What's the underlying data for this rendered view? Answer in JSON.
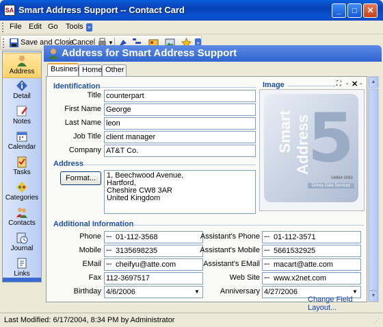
{
  "window": {
    "title": "Smart Address Support -- Contact Card",
    "app_icon_text": "SA"
  },
  "menu": {
    "items": [
      "File",
      "Edit",
      "Go",
      "Tools"
    ]
  },
  "toolbar": {
    "save_close": "Save and Close",
    "cancel": "Cancel"
  },
  "nav": {
    "items": [
      {
        "label": "Address",
        "icon": "person-icon",
        "active": true
      },
      {
        "label": "Detail",
        "icon": "info-icon"
      },
      {
        "label": "Notes",
        "icon": "notes-icon"
      },
      {
        "label": "Calendar",
        "icon": "calendar-icon"
      },
      {
        "label": "Tasks",
        "icon": "tasks-icon"
      },
      {
        "label": "Categories",
        "icon": "categories-icon"
      },
      {
        "label": "Contacts",
        "icon": "contacts-icon"
      },
      {
        "label": "Journal",
        "icon": "journal-icon"
      },
      {
        "label": "Links",
        "icon": "links-icon"
      }
    ]
  },
  "header": {
    "title": "Address for Smart Address Support"
  },
  "tabs": [
    "Business",
    "Home",
    "Other"
  ],
  "identification": {
    "heading": "Identification",
    "title_label": "Title",
    "title": "counterpart",
    "first_name_label": "First Name",
    "first_name": "George",
    "last_name_label": "Last Name",
    "last_name": "leon",
    "job_title_label": "Job Title",
    "job_title": "client manager",
    "company_label": "Company",
    "company": "AT&T Co."
  },
  "image": {
    "heading": "Image",
    "card_line1": "Smart",
    "card_line2": "Address",
    "card_number": "5",
    "card_code": "04864 0063",
    "card_band": "Odney Data Services"
  },
  "address": {
    "heading": "Address",
    "format_button": "Format...",
    "lines": [
      "1, Beechwood Avenue,",
      "Hartford,",
      "Cheshire  CW8 3AR",
      "United Kingdom"
    ]
  },
  "additional": {
    "heading": "Additional Information",
    "phone_label": "Phone",
    "phone": "01-112-3568",
    "mobile_label": "Mobile",
    "mobile": "3135698235",
    "email_label": "EMail",
    "email": "cheifyu@atte.com",
    "fax_label": "Fax",
    "fax": "112-3697517",
    "birthday_label": "Birthday",
    "birthday": "4/6/2006",
    "asst_phone_label": "Assistant's Phone",
    "asst_phone": "01-112-3571",
    "asst_mobile_label": "Assistant's Mobile",
    "asst_mobile": "5661532925",
    "asst_email_label": "Assistant's EMail",
    "asst_email": "macart@atte.com",
    "website_label": "Web Site",
    "website": "www.x2net.com",
    "anniversary_label": "Anniversary",
    "anniversary": "4/27/2006"
  },
  "change_layout": "Change Field Layout...",
  "status": {
    "text": "Last Modified: 6/17/2004, 8:34 PM by Administrator"
  },
  "colors": {
    "title_bar": "#0a52d0",
    "header": "#2f63d0",
    "section": "#1a4ea8",
    "nav": "#b9cdf3"
  }
}
